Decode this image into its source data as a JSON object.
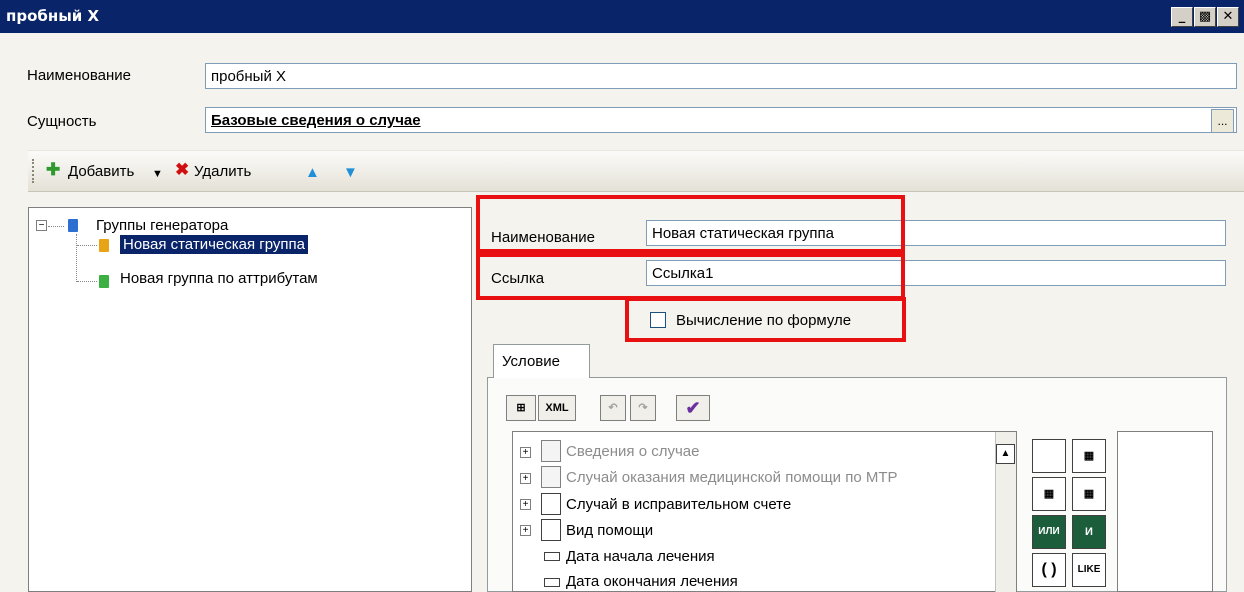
{
  "window": {
    "title": "пробный Х"
  },
  "header": {
    "name_label": "Наименование",
    "name_value": "пробный Х",
    "entity_label": "Сущность",
    "entity_value": "Базовые сведения о случае",
    "entity_button": "..."
  },
  "toolbar": {
    "add_label": "Добавить",
    "delete_label": "Удалить"
  },
  "tree": {
    "root_label": "Группы генератора",
    "items": [
      {
        "label": "Новая статическая группа",
        "color": "#e8a317"
      },
      {
        "label": "Новая группа по аттрибутам",
        "color": "#3cb043"
      }
    ]
  },
  "details": {
    "name_label": "Наименование",
    "name_value": "Новая статическая группа",
    "link_label": "Ссылка",
    "link_value": "Ссылка1",
    "formula_label": "Вычисление по формуле"
  },
  "condition": {
    "tab_label": "Условие",
    "xml_button": "XML",
    "items": [
      {
        "label": "Сведения о случае",
        "enabled": false
      },
      {
        "label": "Случай оказания медицинской помощи по МТР",
        "enabled": false
      },
      {
        "label": "Случай в исправительном счете",
        "enabled": true
      },
      {
        "label": "Вид помощи",
        "enabled": true
      },
      {
        "label": "Дата начала лечения",
        "enabled": true
      },
      {
        "label": "Дата окончания лечения",
        "enabled": true
      }
    ],
    "ops": {
      "or": "ИЛИ",
      "and": "И",
      "parens": "( )",
      "like": "LIKE"
    }
  },
  "colors": {
    "titlebar": "#0a246a",
    "highlight": "#e81010",
    "selection": "#0a246a"
  }
}
